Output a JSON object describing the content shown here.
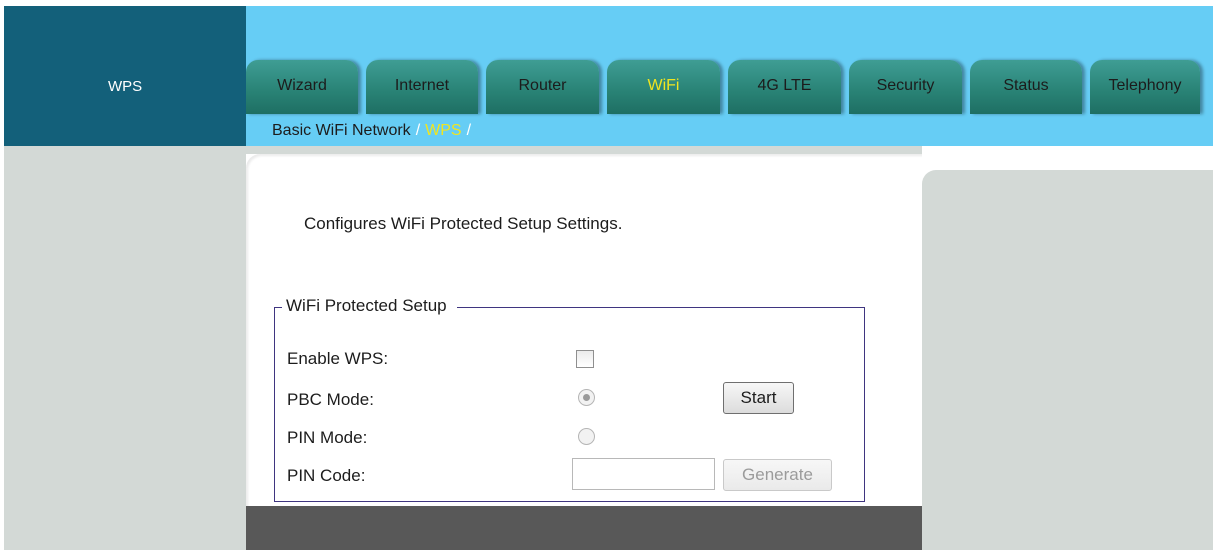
{
  "sidebar": {
    "title": "WPS"
  },
  "tabs": [
    {
      "label": "Wizard",
      "active": false
    },
    {
      "label": "Internet",
      "active": false
    },
    {
      "label": "Router",
      "active": false
    },
    {
      "label": "WiFi",
      "active": true
    },
    {
      "label": "4G LTE",
      "active": false
    },
    {
      "label": "Security",
      "active": false
    },
    {
      "label": "Status",
      "active": false
    },
    {
      "label": "Telephony",
      "active": false
    }
  ],
  "breadcrumb": {
    "parent": "Basic WiFi Network",
    "separator": "/",
    "current": "WPS"
  },
  "page": {
    "description": "Configures WiFi Protected Setup Settings."
  },
  "wps_form": {
    "legend": "WiFi Protected Setup",
    "enable_label": "Enable WPS:",
    "enable_checked": false,
    "pbc_label": "PBC Mode:",
    "pbc_selected": true,
    "start_label": "Start",
    "pin_mode_label": "PIN Mode:",
    "pin_mode_selected": false,
    "pin_code_label": "PIN Code:",
    "pin_code_value": "",
    "generate_label": "Generate",
    "generate_enabled": false
  },
  "colors": {
    "header_blue": "#66cdf5",
    "sidebar_teal": "#13607a",
    "tab_teal": "#2a8477",
    "active_yellow": "#f1e51f",
    "panel_gray": "#d3d9d6",
    "fieldset_border": "#3f3580"
  }
}
